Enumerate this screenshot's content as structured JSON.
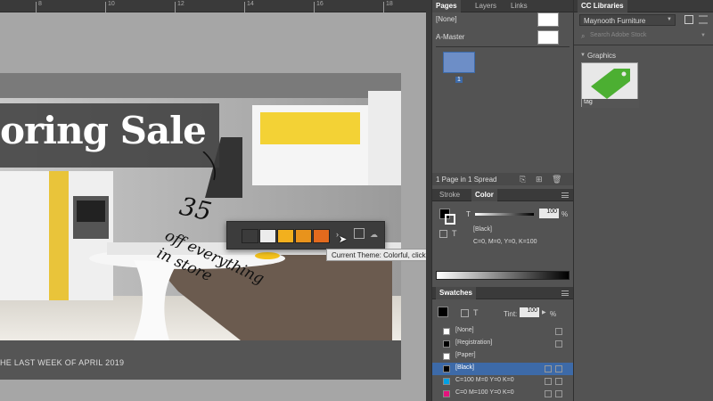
{
  "canvas": {
    "ruler_numbers": [
      "8",
      "10",
      "12",
      "14",
      "16",
      "18"
    ],
    "sale_title": "oring Sale",
    "promo_line1": "35",
    "promo_line2": "off everything",
    "promo_line3": "in store",
    "footer_text": "HE LAST WEEK OF APRIL 2019"
  },
  "theme_popup": {
    "colors": [
      "#3b3b3b",
      "#ececec",
      "#f2b01e",
      "#e8931c",
      "#e36a1d"
    ],
    "tooltip": "Current Theme: Colorful, click to view all themes"
  },
  "pages_panel": {
    "tabs": [
      "Pages",
      "Layers",
      "Links"
    ],
    "none_label": "[None]",
    "master_label": "A-Master",
    "page_number": "1",
    "status": "1 Page in 1 Spread"
  },
  "color_panel": {
    "tabs": [
      "Stroke",
      "Color"
    ],
    "tint_label": "T",
    "tint_value": "100",
    "percent": "%",
    "swatch_name": "[Black]",
    "cmyk": "C=0, M=0, Y=0, K=100"
  },
  "swatches_panel": {
    "tab": "Swatches",
    "tint_label": "Tint:",
    "tint_value": "100",
    "percent": "%",
    "items": [
      {
        "name": "[None]",
        "color": "#ffffff"
      },
      {
        "name": "[Registration]",
        "color": "#000000"
      },
      {
        "name": "[Paper]",
        "color": "#ffffff"
      },
      {
        "name": "[Black]",
        "color": "#000000"
      },
      {
        "name": "C=100 M=0 Y=0 K=0",
        "color": "#00a0e3"
      },
      {
        "name": "C=0 M=100 Y=0 K=0",
        "color": "#e5127d"
      }
    ]
  },
  "cc_libraries": {
    "tab": "CC Libraries",
    "library_name": "Maynooth Furniture",
    "search_placeholder": "Search Adobe Stock",
    "graphics_label": "Graphics",
    "asset_name": "tag"
  }
}
